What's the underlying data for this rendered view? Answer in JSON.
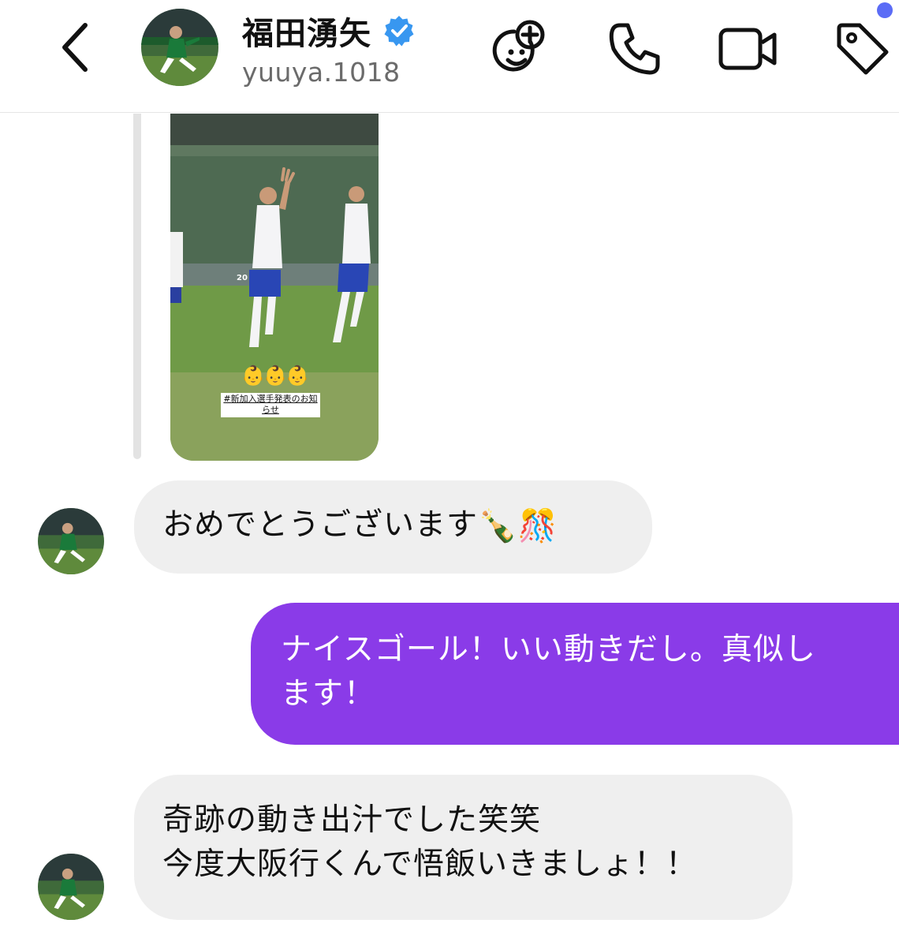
{
  "header": {
    "display_name": "福田湧矢",
    "username": "yuuya.1018",
    "verified": true,
    "icons": [
      "back-chevron-icon",
      "avatar",
      "verified-badge-icon",
      "add-friend-emoji-icon",
      "phone-icon",
      "video-camera-icon",
      "tag-icon"
    ],
    "notification_dot_color": "#5b6cf6"
  },
  "story_reply": {
    "emojis": "👶👶👶",
    "sticker_text": "#新加入選手発表のお知らせ",
    "shirt_number": "20"
  },
  "messages": [
    {
      "direction": "incoming",
      "lines": [
        "おめでとうございます"
      ],
      "trailing_emoji": "🍾🎊"
    },
    {
      "direction": "outgoing",
      "lines": [
        "ナイスゴール！いい動きだし。真似し",
        "ます！"
      ]
    },
    {
      "direction": "incoming",
      "lines": [
        "奇跡の動き出汁でした笑笑",
        "今度大阪行くんで悟飯いきましょ！！"
      ]
    }
  ],
  "colors": {
    "outgoing_bubble": "#8a3be8",
    "incoming_bubble": "#efefef",
    "verified_badge": "#3897f0",
    "accent_dot": "#5b6cf6"
  }
}
